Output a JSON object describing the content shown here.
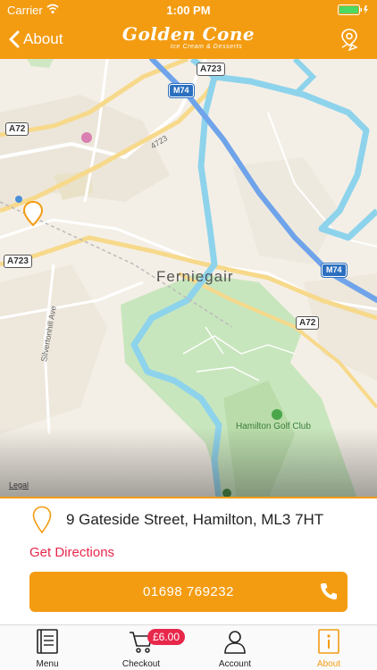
{
  "status": {
    "carrier": "Carrier",
    "time": "1:00 PM"
  },
  "nav": {
    "back_label": "About",
    "brand": "Golden Cone",
    "tagline": "Ice Cream & Desserts"
  },
  "map": {
    "road_labels": [
      "A723",
      "A72",
      "A723",
      "A72",
      "4723"
    ],
    "motorway_labels": [
      "M74",
      "M74"
    ],
    "place": "Ferniegair",
    "street": "Silvertonhill Ave",
    "golf": "Hamilton Golf Club",
    "legal": "Legal"
  },
  "location": {
    "address": "9 Gateside Street, Hamilton, ML3 7HT",
    "directions_label": "Get Directions",
    "phone": "01698 769232"
  },
  "tabs": [
    {
      "label": "Menu",
      "icon": "menu-book-icon"
    },
    {
      "label": "Checkout",
      "icon": "cart-icon",
      "badge": "£6.00"
    },
    {
      "label": "Account",
      "icon": "account-icon"
    },
    {
      "label": "About",
      "icon": "info-icon",
      "active": true
    }
  ],
  "colors": {
    "accent": "#f39c12",
    "link": "#e8274b",
    "motorway": "#2c6fbf",
    "river": "#8ed3ec",
    "park": "#c8e6bd"
  }
}
